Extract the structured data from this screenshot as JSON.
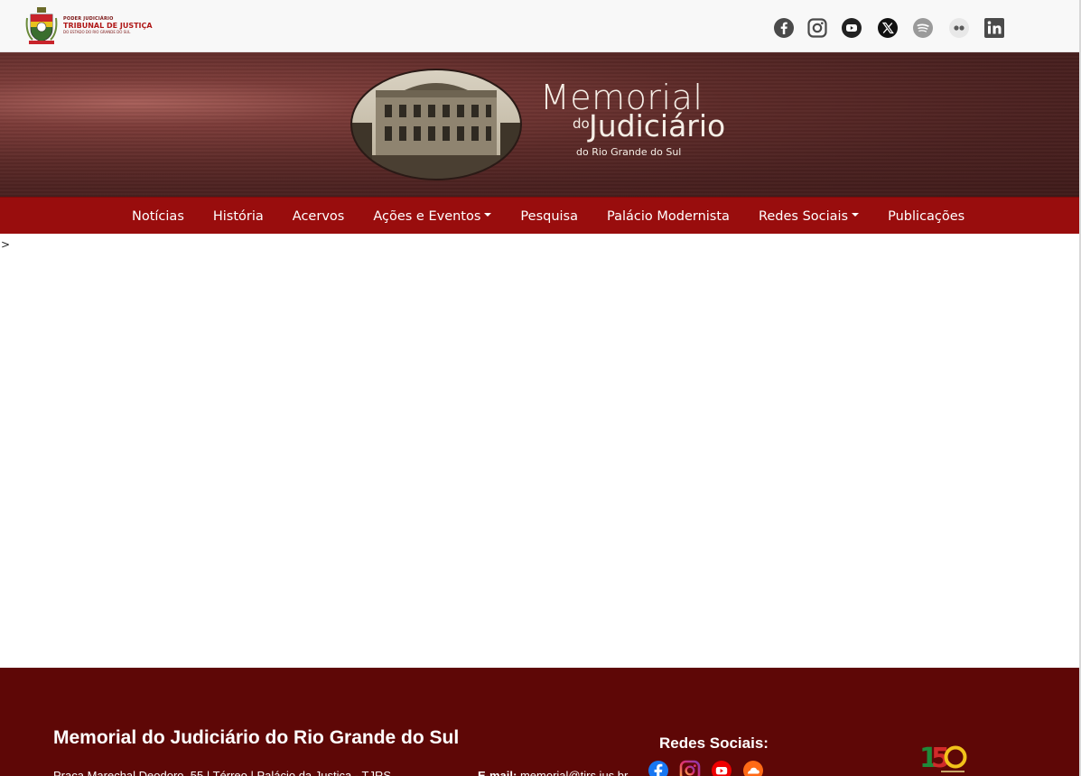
{
  "header": {
    "org_small": "PODER JUDICIÁRIO",
    "org_main": "TRIBUNAL DE JUSTIÇA",
    "org_sub": "DO ESTADO DO RIO GRANDE DO SUL",
    "social_icons": [
      "facebook-icon",
      "instagram-icon",
      "youtube-icon",
      "x-icon",
      "spotify-icon",
      "flickr-icon",
      "linkedin-icon"
    ]
  },
  "banner": {
    "title_line1": "Memorial",
    "title_do": "do",
    "title_line2": "Judiciário",
    "title_line3": "do Rio Grande do Sul"
  },
  "nav": {
    "items": [
      {
        "label": "Notícias"
      },
      {
        "label": "História"
      },
      {
        "label": "Acervos"
      },
      {
        "label": "Ações e Eventos"
      },
      {
        "label": "Pesquisa"
      },
      {
        "label": "Palácio Modernista"
      },
      {
        "label": "Redes Sociais"
      },
      {
        "label": "Publicações"
      }
    ]
  },
  "stray_text": ">",
  "footer": {
    "title": "Memorial do Judiciário do Rio Grande do Sul",
    "address": "Praça Marechal Deodoro, 55 | Térreo | Palácio da Justiça - TJRS",
    "email_label": "E-mail:",
    "email_value": "memorial@tjrs.jus.br",
    "social_title": "Redes Sociais:",
    "social_icons": [
      "facebook-icon",
      "instagram-icon",
      "youtube-icon",
      "soundcloud-icon"
    ],
    "anniversary_logo": "150"
  },
  "colors": {
    "nav_bg": "#990d0d",
    "footer_bg": "#5e0706",
    "banner_bg": "#4a2120"
  }
}
